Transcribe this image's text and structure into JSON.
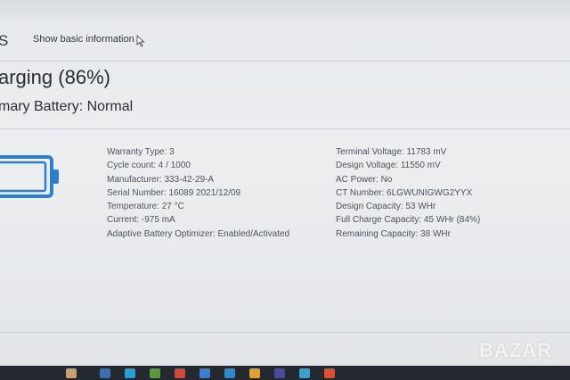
{
  "header": {
    "title_fragment": "S",
    "show_basic_label": "Show basic information"
  },
  "status": {
    "charging": "arging (86%)",
    "primary_battery": "mary Battery: Normal"
  },
  "details_left": [
    "Warranty Type: 3",
    "Cycle count: 4 / 1000",
    "Manufacturer: 333-42-29-A",
    "Serial Number: 16089 2021/12/09",
    "Temperature: 27 °C",
    "Current: -975 mA",
    "Adaptive Battery Optimizer: Enabled/Activated"
  ],
  "details_right": [
    "Terminal Voltage: 11783 mV",
    "Design Voltage: 11550 mV",
    "AC Power: No",
    "CT Number: 6LGWUNIGWG2YYX",
    "Design Capacity: 53 WHr",
    "Full Charge Capacity: 45 WHr (84%)",
    "Remaining Capacity: 38 WHr"
  ],
  "watermark": "BAZAR",
  "colors": {
    "battery_icon": "#2f7fc8",
    "taskbar": "#23292f"
  },
  "icons": [
    "battery-icon",
    "mouse-cursor-icon"
  ]
}
